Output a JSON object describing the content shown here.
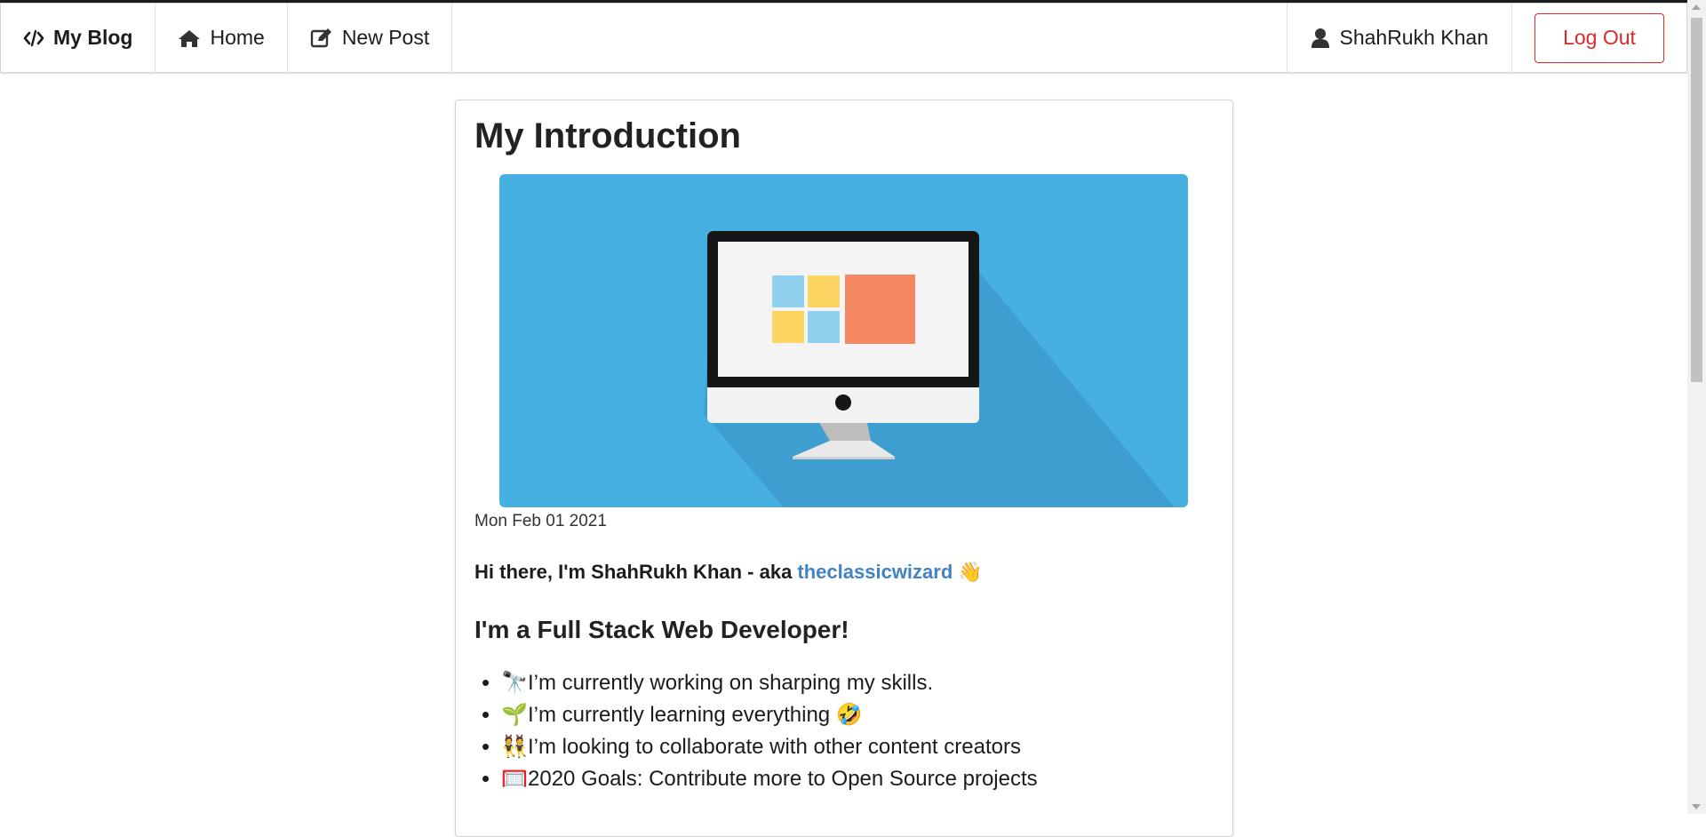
{
  "navbar": {
    "brand_label": "My Blog",
    "brand_icon": "code-icon",
    "home_label": "Home",
    "home_icon": "home-icon",
    "new_post_label": "New Post",
    "new_post_icon": "edit-icon",
    "user_name": "ShahRukh Khan",
    "user_icon": "user-icon",
    "logout_label": "Log Out",
    "logout_color": "#db2828"
  },
  "post": {
    "title": "My Introduction",
    "cover_image": "computer-monitor-illustration",
    "cover_bg_color": "#47b0e2",
    "date": "Mon Feb 01 2021",
    "intro_prefix": "Hi there, I'm ShahRukh Khan - aka ",
    "intro_link": "theclassicwizard",
    "intro_link_color": "#4183c4",
    "intro_emoji": "👋",
    "subheading": "I'm a Full Stack Web Developer!",
    "bullets": [
      {
        "emoji": "🔭",
        "text": "I’m currently working on sharping my skills."
      },
      {
        "emoji": "🌱",
        "text": "I’m currently learning everything 🤣"
      },
      {
        "emoji": "👯",
        "text": "I’m looking to collaborate with other content creators"
      },
      {
        "emoji": "🥅",
        "text": "2020 Goals: Contribute more to Open Source projects"
      }
    ]
  }
}
